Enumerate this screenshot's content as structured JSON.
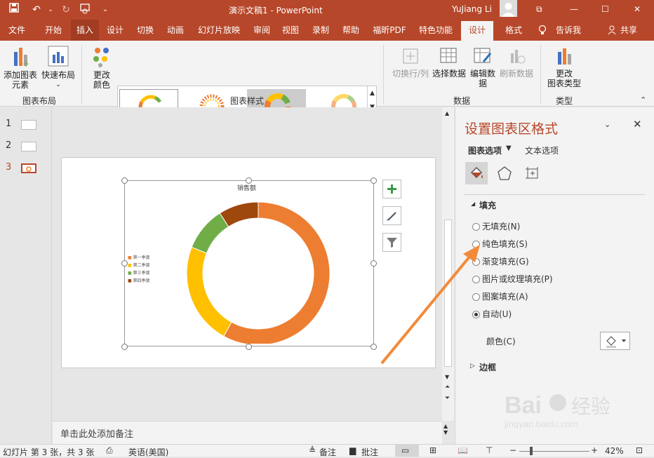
{
  "titlebar": {
    "title": "演示文稿1 - PowerPoint",
    "user": "YuJiang Li",
    "min": "—",
    "max": "☐",
    "close": "✕",
    "restore": "⧉"
  },
  "tabs": [
    "文件",
    "开始",
    "插入",
    "设计",
    "切换",
    "动画",
    "幻灯片放映",
    "审阅",
    "视图",
    "录制",
    "帮助",
    "福昕PDF",
    "特色功能",
    "设计",
    "格式",
    "告诉我",
    "共享"
  ],
  "ribbon": {
    "add_element_1": "添加图表",
    "add_element_2": "元素",
    "quick_layout": "快速布局",
    "change_color_1": "更改",
    "change_color_2": "颜色",
    "group_layout": "图表布局",
    "group_styles": "图表样式",
    "switch_rowcol": "切换行/列",
    "select_data": "选择数据",
    "edit_data_1": "编辑数",
    "edit_data_2": "据",
    "refresh_data": "刷新数据",
    "group_data": "数据",
    "change_type_1": "更改",
    "change_type_2": "图表类型",
    "group_type": "类型"
  },
  "slides": [
    "1",
    "2",
    "3"
  ],
  "chart": {
    "title": "销售额",
    "legend": [
      "第一季度",
      "第二季度",
      "第三季度",
      "第四季度"
    ]
  },
  "chart_data": {
    "type": "pie",
    "title": "销售额",
    "categories": [
      "第一季度",
      "第二季度",
      "第三季度",
      "第四季度"
    ],
    "values": [
      58,
      23,
      10,
      9
    ],
    "colors": [
      "#ed7d31",
      "#ffc000",
      "#70ad47",
      "#9e480e"
    ],
    "legend_position": "left"
  },
  "notes": {
    "placeholder": "单击此处添加备注"
  },
  "pane": {
    "title": "设置图表区格式",
    "tab_chart": "图表选项",
    "tab_text": "文本选项",
    "section_fill": "填充",
    "options": [
      "无填充(N)",
      "纯色填充(S)",
      "渐变填充(G)",
      "图片或纹理填充(P)",
      "图案填充(A)",
      "自动(U)"
    ],
    "selected": "自动(U)",
    "color_label": "颜色(C)",
    "section_border": "边框"
  },
  "status": {
    "slide_info": "幻灯片 第 3 张，共 3 张",
    "language": "英语(美国)",
    "notes_btn": "备注",
    "comments_btn": "批注",
    "zoom": "42%"
  },
  "watermark": {
    "text": "Bai 经验",
    "url": "jingyan.baidu.com"
  }
}
